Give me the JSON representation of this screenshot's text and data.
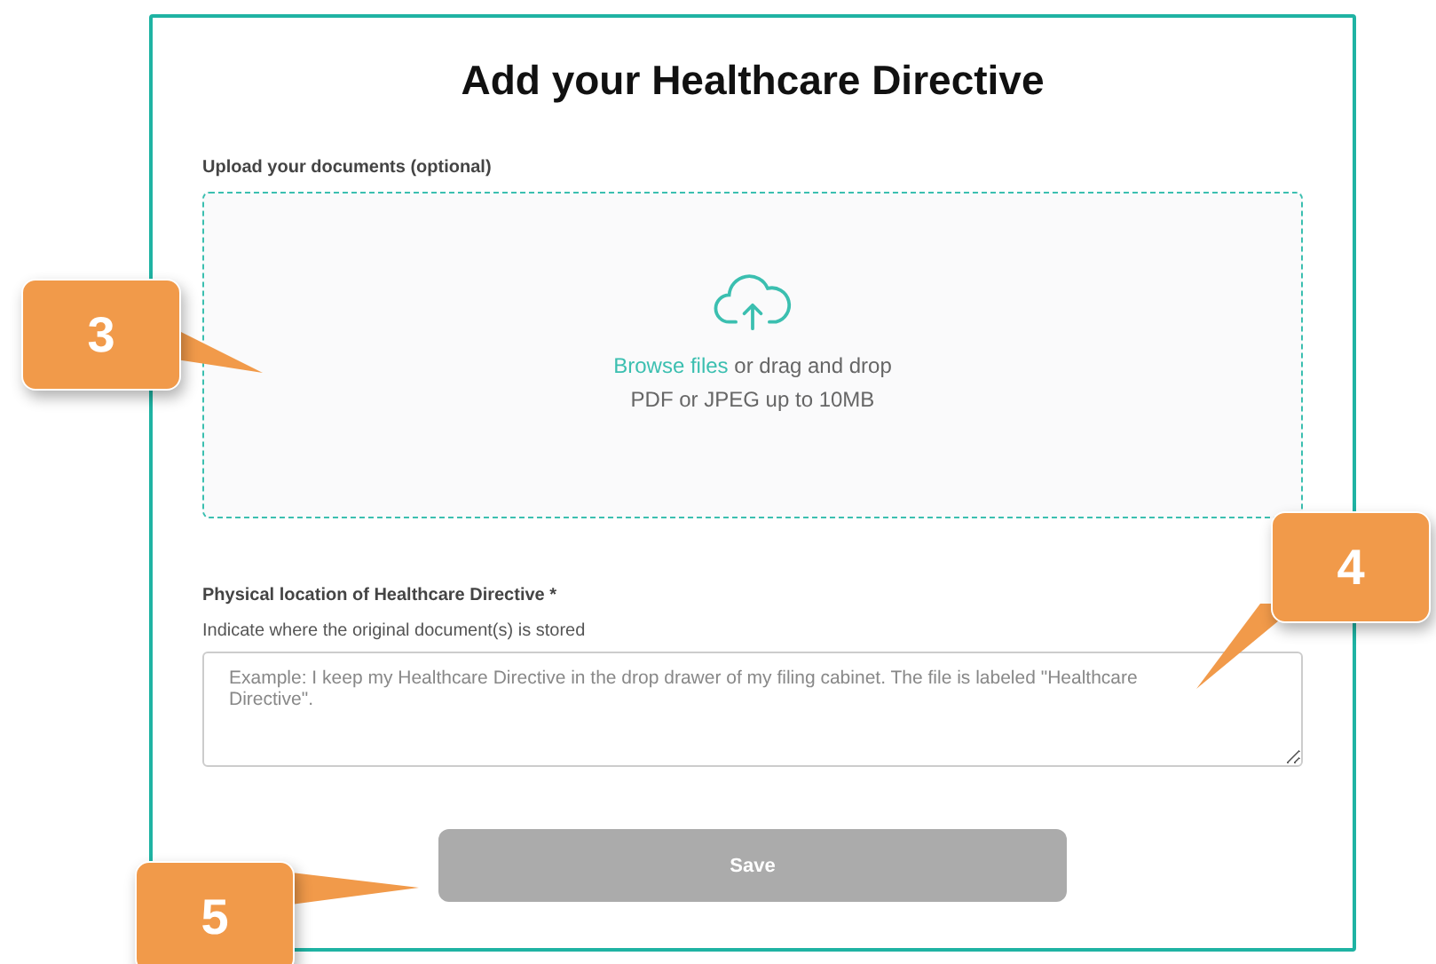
{
  "title": "Add your Healthcare Directive",
  "upload": {
    "label": "Upload your documents (optional)",
    "link": "Browse files",
    "text": "or drag and drop",
    "hint": "PDF or JPEG up to 10MB"
  },
  "location": {
    "label": "Physical location of Healthcare Directive *",
    "hint": "Indicate where the original document(s) is stored",
    "placeholder": "Example: I keep my Healthcare Directive in the drop drawer of my filing cabinet. The file is labeled \"Healthcare Directive\"."
  },
  "save": {
    "label": "Save",
    "disabled": true
  },
  "callouts": [
    {
      "number": "3",
      "kind": "left"
    },
    {
      "number": "4",
      "kind": "right"
    },
    {
      "number": "5",
      "kind": "bottom"
    }
  ]
}
